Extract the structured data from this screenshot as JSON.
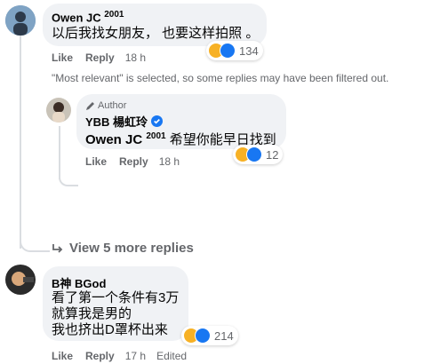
{
  "comment1": {
    "author": "Owen JC",
    "author_sup": "2001",
    "text": "以后我找女朋友， 也要这样拍照 。",
    "reactions_count": "134",
    "like_label": "Like",
    "reply_label": "Reply",
    "time": "18 h"
  },
  "filter_notice": "\"Most relevant\" is selected, so some replies may have been filtered out.",
  "reply1": {
    "author_badge": "Author",
    "author": "YBB 楊虹玲",
    "mention": "Owen JC",
    "mention_sup": "2001",
    "text": "希望你能早日找到",
    "reactions_count": "12",
    "like_label": "Like",
    "reply_label": "Reply",
    "time": "18 h"
  },
  "view_more": "View 5 more replies",
  "comment2": {
    "author": "B神 BGod",
    "lines": [
      "看了第一个条件有3万",
      "就算我是男的",
      "我也挤出D罩杯出来"
    ],
    "reactions_count": "214",
    "like_label": "Like",
    "reply_label": "Reply",
    "time": "17 h",
    "edited": "Edited"
  },
  "colors": {
    "bubble": "#f0f2f5",
    "meta": "#65676b",
    "like_blue": "#1877f2",
    "haha_yellow": "#f7b125"
  }
}
